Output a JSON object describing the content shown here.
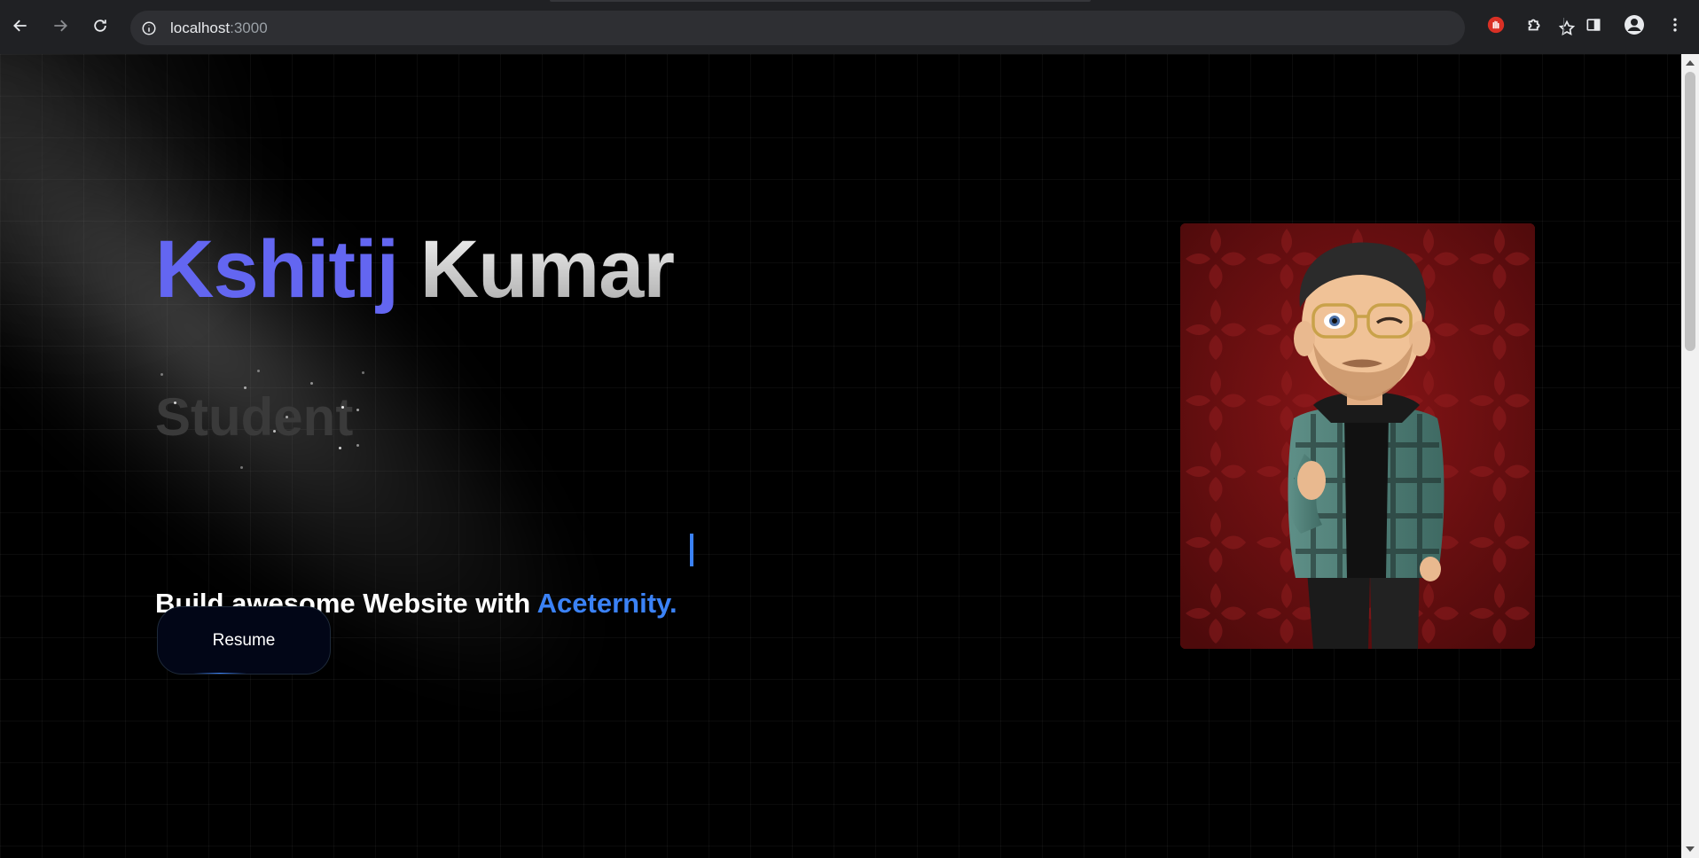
{
  "browser": {
    "url_host": "localhost",
    "url_port": ":3000"
  },
  "hero": {
    "first_name": "Kshitij",
    "last_name": "Kumar",
    "role": "Student",
    "tagline_prefix": "Build awesome Website with",
    "tagline_accent": "Aceternity.",
    "resume_label": "Resume"
  },
  "colors": {
    "accent_name": "#6366f1",
    "accent_tagline": "#3b82f6",
    "background": "#000000"
  }
}
